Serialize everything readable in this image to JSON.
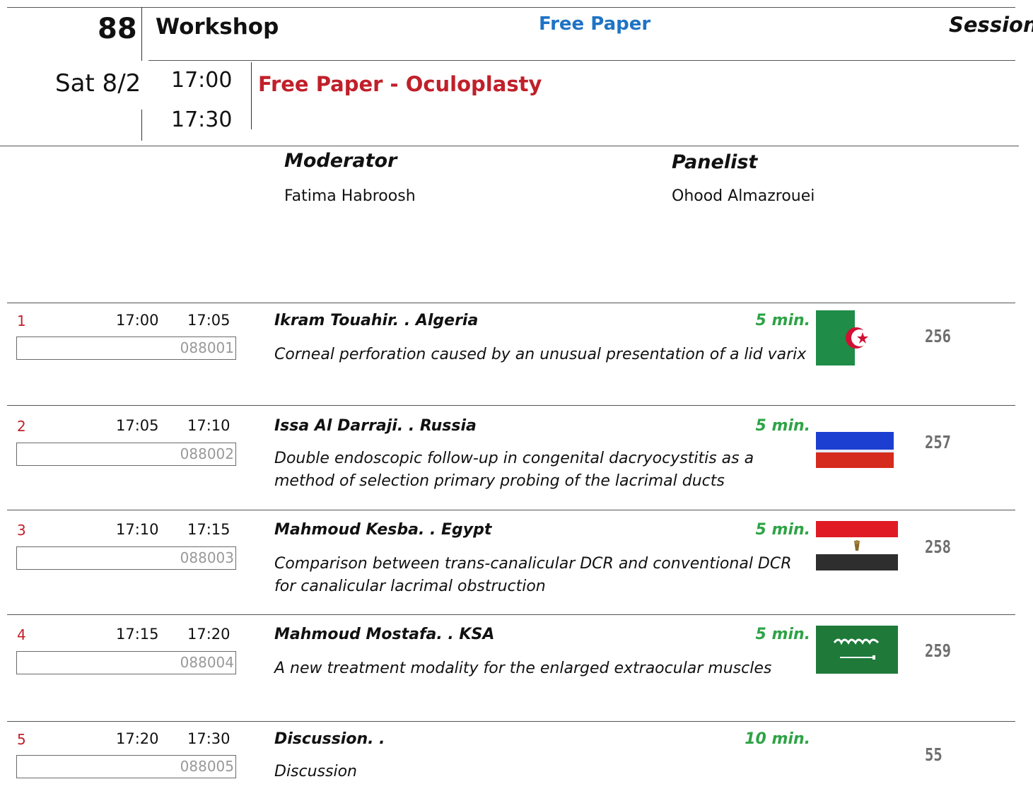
{
  "session": {
    "number": "88",
    "type": "Workshop",
    "category": "Free Paper",
    "label": "Session",
    "day": "Sat 8/2",
    "start": "17:00",
    "end": "17:30",
    "title": "Free Paper - Oculoplasty"
  },
  "roles": {
    "moderator_title": "Moderator",
    "moderator_name": "Fatima Habroosh",
    "panelist_title": "Panelist",
    "panelist_name": "Ohood Almazrouei"
  },
  "rows": [
    {
      "index": "1",
      "start": "17:00",
      "end": "17:05",
      "code": "088001",
      "speaker": "Ikram Touahir. . Algeria",
      "duration": "5 min.",
      "talk": "Corneal perforation caused by an unusual presentation of a lid varix",
      "abstract_no": "256",
      "flag_icon": "algeria-flag-icon"
    },
    {
      "index": "2",
      "start": "17:05",
      "end": "17:10",
      "code": "088002",
      "speaker": "Issa Al Darraji. . Russia",
      "duration": "5 min.",
      "talk": "Double endoscopic follow-up in congenital dacryocystitis as a method of selection primary probing of the lacrimal ducts",
      "abstract_no": "257",
      "flag_icon": "russia-flag-icon"
    },
    {
      "index": "3",
      "start": "17:10",
      "end": "17:15",
      "code": "088003",
      "speaker": "Mahmoud Kesba. . Egypt",
      "duration": "5 min.",
      "talk": "Comparison between trans-canalicular DCR and conventional DCR for canalicular lacrimal obstruction",
      "abstract_no": "258",
      "flag_icon": "egypt-flag-icon"
    },
    {
      "index": "4",
      "start": "17:15",
      "end": "17:20",
      "code": "088004",
      "speaker": "Mahmoud Mostafa. . KSA",
      "duration": "5 min.",
      "talk": "A new treatment modality for the enlarged extraocular muscles",
      "abstract_no": "259",
      "flag_icon": "saudi-flag-icon"
    },
    {
      "index": "5",
      "start": "17:20",
      "end": "17:30",
      "code": "088005",
      "speaker": "Discussion. .",
      "duration": "10 min.",
      "talk": "Discussion",
      "abstract_no": "55",
      "flag_icon": ""
    }
  ],
  "colors": {
    "category": "#1f73c4",
    "title": "#c0202a",
    "duration": "#2ea346",
    "abstract_no": "#6e6e6e"
  }
}
